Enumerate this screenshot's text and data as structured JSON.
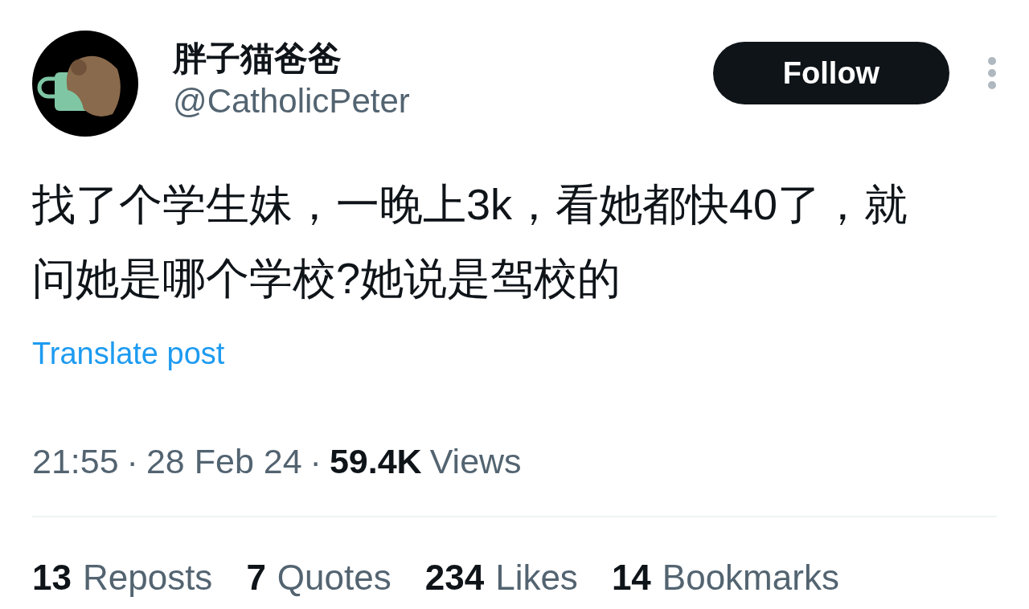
{
  "author": {
    "name": "胖子猫爸爸",
    "handle": "@CatholicPeter"
  },
  "follow_button": {
    "label": "Follow"
  },
  "post": {
    "text": "找了个学生妹，一晚上3k，看她都快40了，就问她是哪个学校?她说是驾校的",
    "translate_link": "Translate post"
  },
  "meta": {
    "time": "21:55",
    "separator_1": "·",
    "date": "28 Feb 24",
    "separator_2": "·",
    "views_count": "59.4K",
    "views_label": "Views"
  },
  "stats": [
    {
      "count": "13",
      "label": "Reposts"
    },
    {
      "count": "7",
      "label": "Quotes"
    },
    {
      "count": "234",
      "label": "Likes"
    },
    {
      "count": "14",
      "label": "Bookmarks"
    }
  ]
}
